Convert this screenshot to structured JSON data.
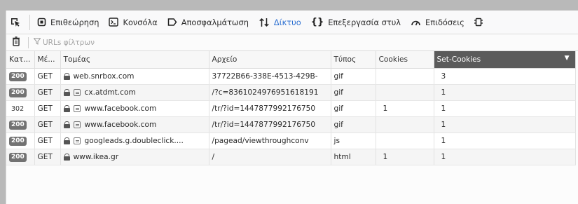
{
  "toolbar": {
    "tabs": [
      {
        "label": "Επιθεώρηση",
        "icon": "inspector-icon"
      },
      {
        "label": "Κονσόλα",
        "icon": "console-icon"
      },
      {
        "label": "Αποσφαλμάτωση",
        "icon": "debugger-icon"
      },
      {
        "label": "Δίκτυο",
        "icon": "network-icon",
        "active": true
      },
      {
        "label": "Επεξεργασία στυλ",
        "icon": "style-editor-icon"
      },
      {
        "label": "Επιδόσεις",
        "icon": "performance-icon"
      }
    ]
  },
  "filter": {
    "placeholder": "URLs φίλτρων",
    "value": ""
  },
  "columns": [
    "Κατ...",
    "Μέ...",
    "Τομέας",
    "Αρχείο",
    "Τύπος",
    "Cookies",
    "Set-Cookies"
  ],
  "sorted_column": "Set-Cookies",
  "rows": [
    {
      "status": "200",
      "method": "GET",
      "domain": "web.snrbox.com",
      "tracker": false,
      "file": "37722B66-338E-4513-429B-",
      "type": "gif",
      "cookies": "",
      "set_cookies": "3"
    },
    {
      "status": "200",
      "method": "GET",
      "domain": "cx.atdmt.com",
      "tracker": true,
      "file": "/?c=8361024976951618191",
      "type": "gif",
      "cookies": "",
      "set_cookies": "1"
    },
    {
      "status": "302",
      "method": "GET",
      "domain": "www.facebook.com",
      "tracker": true,
      "file": "/tr/?id=1447877992176750",
      "type": "gif",
      "cookies": "1",
      "set_cookies": "1"
    },
    {
      "status": "200",
      "method": "GET",
      "domain": "www.facebook.com",
      "tracker": true,
      "file": "/tr/?id=1447877992176750",
      "type": "gif",
      "cookies": "",
      "set_cookies": "1"
    },
    {
      "status": "200",
      "method": "GET",
      "domain": "googleads.g.doubleclick....",
      "tracker": true,
      "file": "/pagead/viewthroughconv",
      "type": "js",
      "cookies": "",
      "set_cookies": "1"
    },
    {
      "status": "200",
      "method": "GET",
      "domain": "www.ikea.gr",
      "tracker": false,
      "file": "/",
      "type": "html",
      "cookies": "1",
      "set_cookies": "1"
    }
  ],
  "colors": {
    "active_tab": "#2b6fd1",
    "sorted_header": "#5b5b5b",
    "status_badge": "#727272"
  }
}
